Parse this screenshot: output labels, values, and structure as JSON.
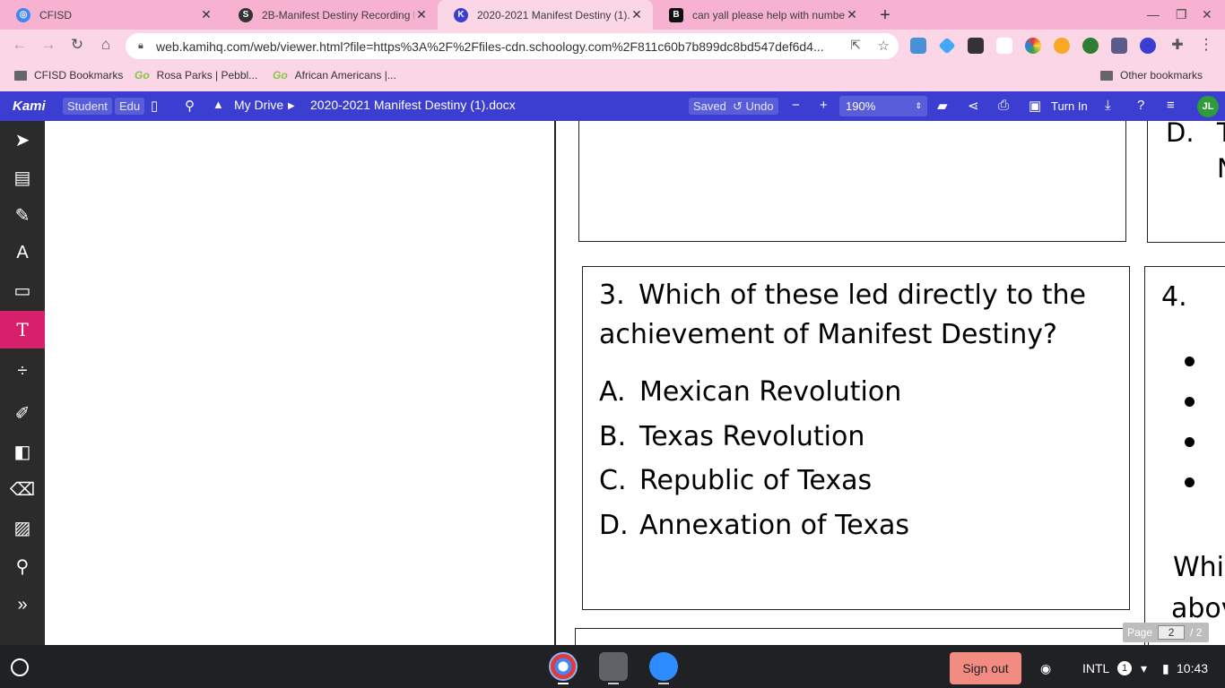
{
  "tabs": [
    {
      "title": "CFISD",
      "icon": "chrome-icon",
      "active": false
    },
    {
      "title": "2B-Manifest Destiny Recording D",
      "icon": "schoology-icon",
      "active": false
    },
    {
      "title": "2020-2021 Manifest Destiny (1).",
      "icon": "kami-icon",
      "active": true
    },
    {
      "title": "can yall please help with numbe",
      "icon": "brainly-icon",
      "active": false
    }
  ],
  "address": {
    "url": "web.kamihq.com/web/viewer.html?file=https%3A%2F%2Ffiles-cdn.schoology.com%2F811c60b7b899dc8bd547def6d4..."
  },
  "bookmarks": [
    {
      "label": "CFISD Bookmarks",
      "icon": "folder-icon"
    },
    {
      "label": "Rosa Parks | Pebbl...",
      "icon": "go-icon"
    },
    {
      "label": "African Americans |...",
      "icon": "go-icon"
    }
  ],
  "other_bookmarks": "Other bookmarks",
  "kami": {
    "logo": "Kami",
    "student": "Student",
    "edu": "Edu",
    "drive": "My Drive",
    "filename": "2020-2021 Manifest Destiny (1).docx",
    "saved": "Saved",
    "undo": "Undo",
    "zoom": "190%",
    "turn_in": "Turn In",
    "avatar": "JL"
  },
  "tool_panel": {
    "font_size": "16",
    "colors": [
      "#000000",
      "#0a8a0a",
      "#9b30ff"
    ]
  },
  "document": {
    "left_box": {
      "option_d": "D.",
      "option_d_partial": "T",
      "partial_line": "N"
    },
    "question3": {
      "number": "3.",
      "line1": "Which of these led directly to the",
      "line2": "achievement of Manifest Destiny?",
      "options": [
        {
          "letter": "A.",
          "text": "Mexican Revolution"
        },
        {
          "letter": "B.",
          "text": "Texas Revolution"
        },
        {
          "letter": "C.",
          "text": "Republic of Texas"
        },
        {
          "letter": "D.",
          "text": "Annexation of Texas"
        }
      ]
    },
    "question4": {
      "number": "4.",
      "partial_line1": "Whi",
      "partial_line2": "abov"
    }
  },
  "pager": {
    "label": "Page",
    "current": "2",
    "total": "/ 2"
  },
  "shelf": {
    "sign_out": "Sign out",
    "keyboard": "INTL",
    "notifications": "1",
    "time": "10:43"
  }
}
